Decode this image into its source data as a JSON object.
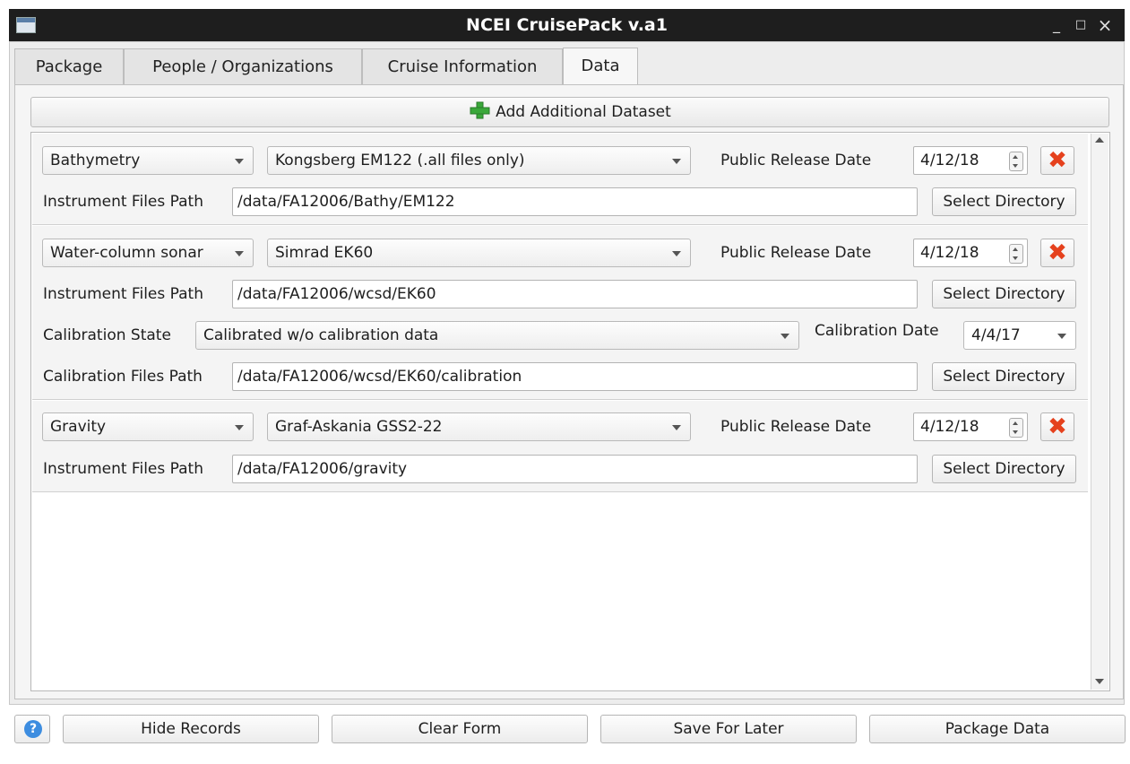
{
  "window": {
    "title": "NCEI CruisePack v.a1",
    "controls": {
      "minimize": "_",
      "maximize": "□",
      "close": "×"
    }
  },
  "tabs": [
    {
      "label": "Package",
      "active": false
    },
    {
      "label": "People / Organizations",
      "active": false
    },
    {
      "label": "Cruise Information",
      "active": false
    },
    {
      "label": "Data",
      "active": true
    }
  ],
  "add_dataset_label": "Add Additional Dataset",
  "records": [
    {
      "type": "Bathymetry",
      "instrument": "Kongsberg EM122 (.all files only)",
      "release_label": "Public Release Date",
      "release_date": "4/12/18",
      "path_label": "Instrument Files Path",
      "path": "/data/FA12006/Bathy/EM122",
      "select_label": "Select Directory"
    },
    {
      "type": "Water-column sonar",
      "instrument": "Simrad EK60",
      "release_label": "Public Release Date",
      "release_date": "4/12/18",
      "path_label": "Instrument Files Path",
      "path": "/data/FA12006/wcsd/EK60",
      "select_label": "Select Directory",
      "calibration_state_label": "Calibration State",
      "calibration_state": "Calibrated w/o calibration data",
      "calibration_date_label": "Calibration Date",
      "calibration_date": "4/4/17",
      "calibration_path_label": "Calibration Files Path",
      "calibration_path": "/data/FA12006/wcsd/EK60/calibration",
      "calibration_select_label": "Select Directory"
    },
    {
      "type": "Gravity",
      "instrument": "Graf-Askania GSS2-22",
      "release_label": "Public Release Date",
      "release_date": "4/12/18",
      "path_label": "Instrument Files Path",
      "path": "/data/FA12006/gravity",
      "select_label": "Select Directory"
    }
  ],
  "bottom_buttons": {
    "help": "?",
    "hide_records": "Hide Records",
    "clear_form": "Clear Form",
    "save_for_later": "Save For Later",
    "package_data": "Package Data"
  },
  "colors": {
    "titlebar": "#1e1e1e",
    "delete_icon": "#e5411d",
    "add_icon": "#3aa83a",
    "help_icon": "#3d8de0"
  },
  "icons": {
    "app": "app-window-icon",
    "add": "green-plus-icon",
    "delete": "red-x-icon",
    "help": "help-circle-icon"
  }
}
